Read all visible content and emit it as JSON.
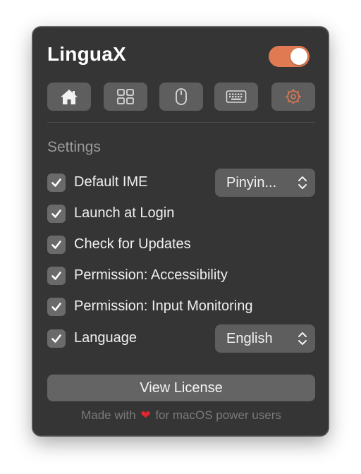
{
  "app": {
    "title": "LinguaX",
    "enabled": true,
    "accent_color": "#e07a52"
  },
  "tabs": [
    {
      "icon": "home-icon",
      "active": false
    },
    {
      "icon": "grid-icon",
      "active": false
    },
    {
      "icon": "mouse-icon",
      "active": false
    },
    {
      "icon": "keyboard-icon",
      "active": false
    },
    {
      "icon": "gear-icon",
      "active": true
    }
  ],
  "settings": {
    "title": "Settings",
    "rows": [
      {
        "label": "Default IME",
        "checked": true,
        "select": "Pinyin..."
      },
      {
        "label": "Launch at Login",
        "checked": true
      },
      {
        "label": "Check for Updates",
        "checked": true
      },
      {
        "label": "Permission: Accessibility",
        "checked": true
      },
      {
        "label": "Permission: Input Monitoring",
        "checked": true
      },
      {
        "label": "Language",
        "checked": true,
        "select": "English"
      }
    ]
  },
  "license_button": "View License",
  "footer": {
    "prefix": "Made with",
    "heart": "❤",
    "suffix": "for macOS power users",
    "heart_color": "#e0262e"
  }
}
